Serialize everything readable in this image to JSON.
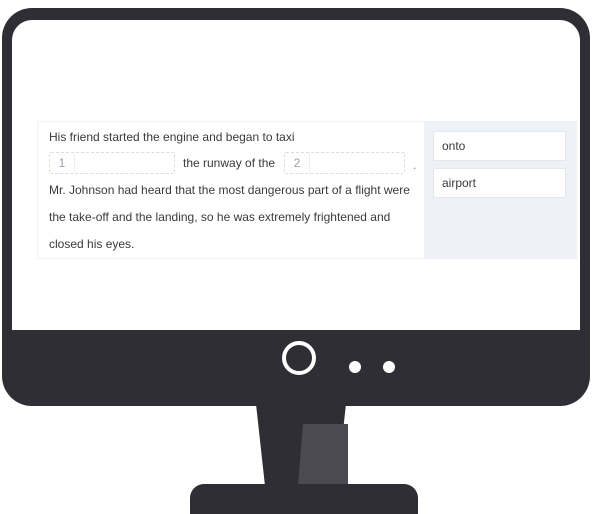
{
  "passage": {
    "line1": "His friend started the engine and began to taxi",
    "blank1_number": "1",
    "between_blanks": "the runway of the",
    "blank2_number": "2",
    "after_blank2": ".",
    "line3": "Mr. Johnson had heard that the most dangerous part of a flight were",
    "line4": "the take-off and the landing, so he was extremely frightened and",
    "line5": "closed his eyes."
  },
  "options": [
    "onto",
    "airport"
  ],
  "colors": {
    "monitor": "#2f2e35",
    "screen": "#ffffff",
    "options_panel": "#eef1f5"
  },
  "icons": [
    "power-button-icon",
    "indicator-dot-icon",
    "indicator-dot-icon"
  ]
}
